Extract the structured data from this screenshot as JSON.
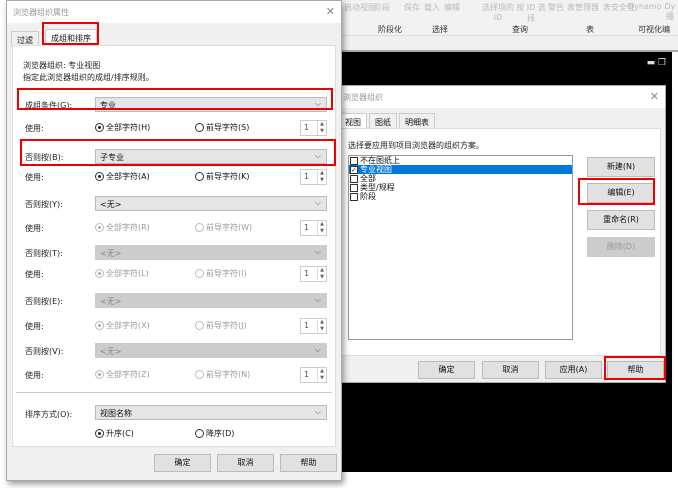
{
  "ribbon": {
    "items": [
      "启动视图",
      "阶段",
      "保存",
      "载入",
      "编辑",
      "选择项的 ID",
      "按 ID 选择",
      "警告",
      "表管理器",
      "表安全性",
      "Dynamo",
      "Dy播"
    ],
    "groups": [
      "阶段化",
      "选择",
      "查询",
      "表",
      "可视化编"
    ]
  },
  "left_dialog": {
    "title": "浏览器组织属性",
    "tabs": [
      "过滤",
      "成组和排序"
    ],
    "browser_org": "浏览器组织: 专业视图",
    "desc": "指定此浏览器组织的成组/排序规则。",
    "rows": [
      {
        "label": "成组条件(G):",
        "value": "专业",
        "use": "使用:",
        "all": "全部字符(H)",
        "lead": "前导字符(S)",
        "n": "1",
        "enabled": true
      },
      {
        "label": "否则按(B):",
        "value": "子专业",
        "use": "使用:",
        "all": "全部字符(A)",
        "lead": "前导字符(K)",
        "n": "1",
        "enabled": true
      },
      {
        "label": "否则按(Y):",
        "value": "<无>",
        "use": "使用:",
        "all": "全部字符(R)",
        "lead": "前导字符(W)",
        "n": "1",
        "enabled": true
      },
      {
        "label": "否则按(T):",
        "value": "<无>",
        "use": "使用:",
        "all": "全部字符(L)",
        "lead": "前导字符(I)",
        "n": "1",
        "enabled": false
      },
      {
        "label": "否则按(E):",
        "value": "<无>",
        "use": "使用:",
        "all": "全部字符(X)",
        "lead": "前导字符(J)",
        "n": "1",
        "enabled": false
      },
      {
        "label": "否则按(V):",
        "value": "<无>",
        "use": "使用:",
        "all": "全部字符(Z)",
        "lead": "前导字符(N)",
        "n": "1",
        "enabled": false
      }
    ],
    "sort_label": "排序方式(O):",
    "sort_value": "视图名称",
    "asc": "升序(C)",
    "desc_order": "降序(D)",
    "buttons": {
      "ok": "确定",
      "cancel": "取消",
      "help": "帮助"
    }
  },
  "right_dialog": {
    "title": "浏览器组织",
    "tabs": [
      "视图",
      "图纸",
      "明细表"
    ],
    "prompt": "选择要应用到项目浏览器的组织方案。",
    "items": [
      {
        "label": "不在图纸上",
        "checked": false
      },
      {
        "label": "专业视图",
        "checked": true
      },
      {
        "label": "全部",
        "checked": false
      },
      {
        "label": "类型/规程",
        "checked": false
      },
      {
        "label": "阶段",
        "checked": false
      }
    ],
    "side_buttons": {
      "new": "新建(N)",
      "edit": "编辑(E)",
      "rename": "重命名(R)",
      "delete": "删除(D)"
    },
    "buttons": {
      "ok": "确定",
      "cancel": "取消",
      "apply": "应用(A)",
      "help": "帮助"
    }
  },
  "accent": "#0078d7",
  "highlight": "#e00000"
}
